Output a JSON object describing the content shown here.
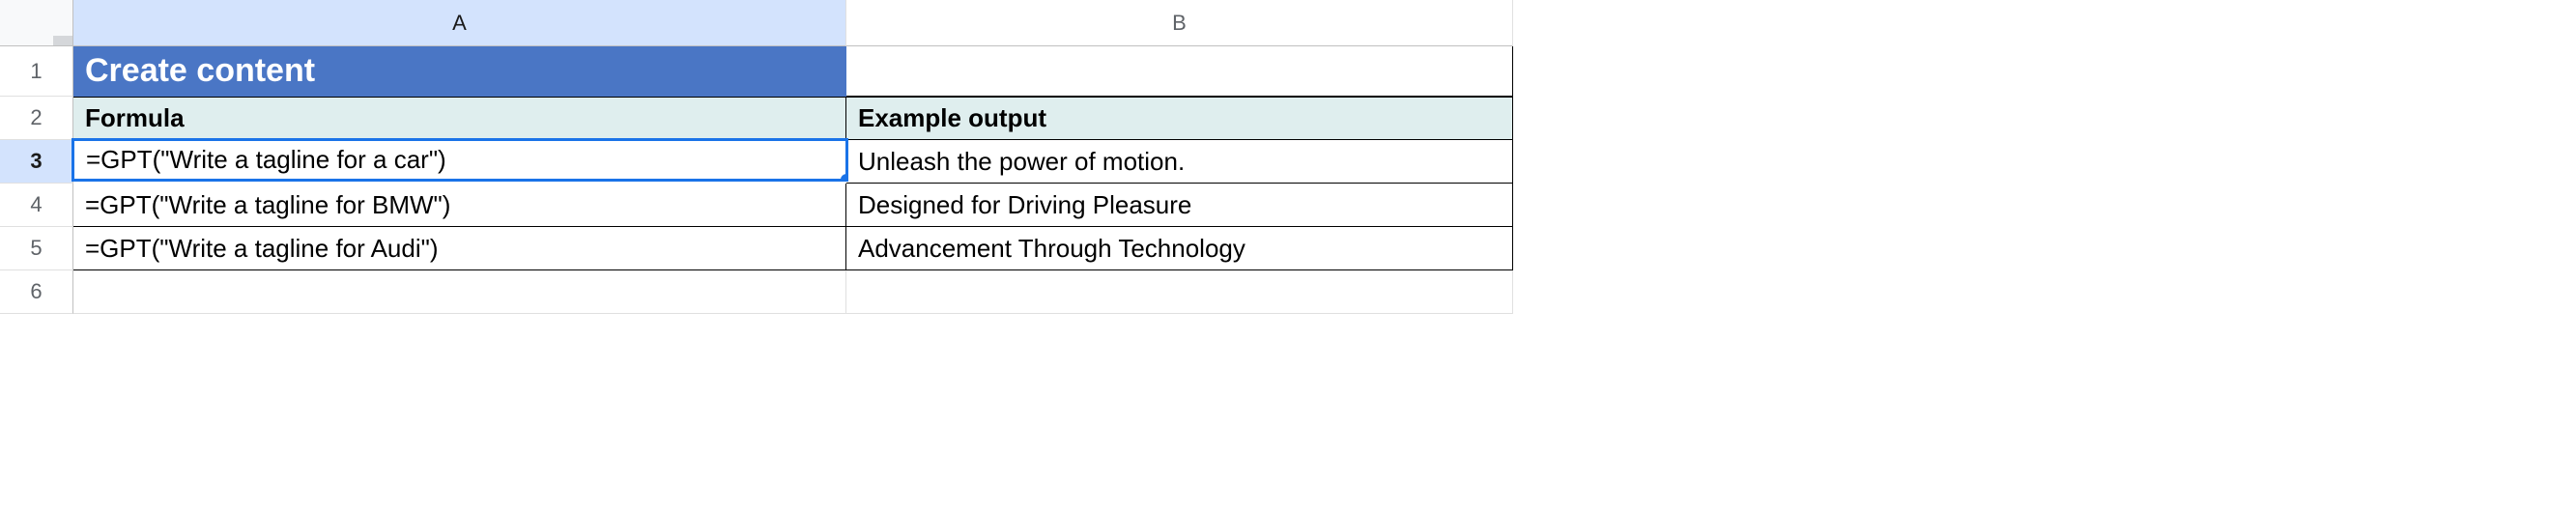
{
  "columns": {
    "A": "A",
    "B": "B"
  },
  "rows": {
    "1": "1",
    "2": "2",
    "3": "3",
    "4": "4",
    "5": "5",
    "6": "6"
  },
  "cells": {
    "A1": "Create content",
    "B1": "",
    "A2": "Formula",
    "B2": "Example output",
    "A3": "=GPT(\"Write a tagline for a car\")",
    "B3": "Unleash the power of motion.",
    "A4": "=GPT(\"Write a tagline for BMW\")",
    "B4": "Designed for Driving Pleasure",
    "A5": "=GPT(\"Write a tagline for Audi\")",
    "B5": "Advancement Through Technology",
    "A6": "",
    "B6": ""
  },
  "selected_cell": "A3",
  "chart_data": {
    "type": "table",
    "title": "Create content",
    "columns": [
      "Formula",
      "Example output"
    ],
    "rows": [
      [
        "=GPT(\"Write a tagline for a car\")",
        "Unleash the power of motion."
      ],
      [
        "=GPT(\"Write a tagline for BMW\")",
        "Designed for Driving Pleasure"
      ],
      [
        "=GPT(\"Write a tagline for Audi\")",
        "Advancement Through Technology"
      ]
    ]
  }
}
